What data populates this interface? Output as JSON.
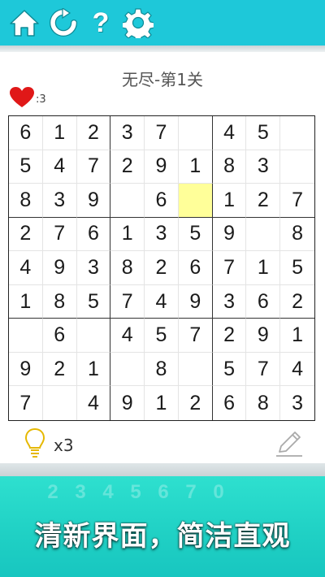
{
  "toolbar": {
    "home_icon": "home-icon",
    "restart_icon": "restart-icon",
    "help_label": "?",
    "settings_icon": "gear-icon",
    "bg_color": "#1ec8d9"
  },
  "game": {
    "title": "无尽-第1关",
    "lives": ":3",
    "hints": "x3",
    "selected_cell": [
      2,
      5
    ],
    "highlight_color": "#ffff99"
  },
  "grid": [
    [
      "6",
      "1",
      "2",
      "3",
      "7",
      "",
      "4",
      "5",
      ""
    ],
    [
      "5",
      "4",
      "7",
      "2",
      "9",
      "1",
      "8",
      "3",
      ""
    ],
    [
      "8",
      "3",
      "9",
      "",
      "6",
      "",
      "1",
      "2",
      "7"
    ],
    [
      "2",
      "7",
      "6",
      "1",
      "3",
      "5",
      "9",
      "",
      "8"
    ],
    [
      "4",
      "9",
      "3",
      "8",
      "2",
      "6",
      "7",
      "1",
      "5"
    ],
    [
      "1",
      "8",
      "5",
      "7",
      "4",
      "9",
      "3",
      "6",
      "2"
    ],
    [
      "",
      "6",
      "",
      "4",
      "5",
      "7",
      "2",
      "9",
      "1"
    ],
    [
      "9",
      "2",
      "1",
      "",
      "8",
      "",
      "5",
      "7",
      "4"
    ],
    [
      "7",
      "",
      "4",
      "9",
      "1",
      "2",
      "6",
      "8",
      "3"
    ]
  ],
  "banner": {
    "ghost_numbers": [
      "2",
      "3",
      "4",
      "5",
      "6",
      "7",
      "0"
    ],
    "slogan": "清新界面，简洁直观"
  }
}
